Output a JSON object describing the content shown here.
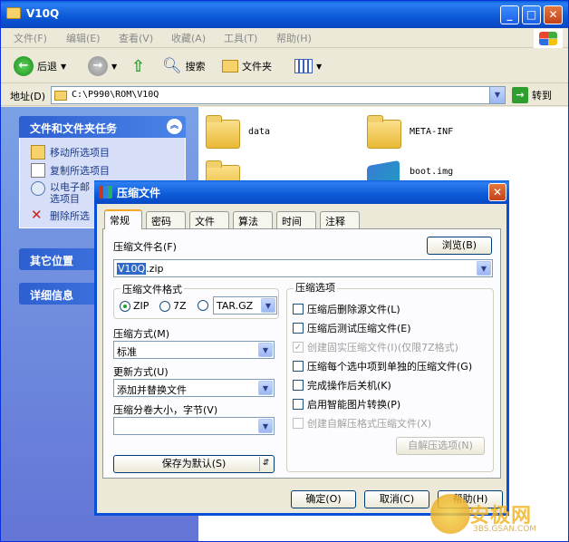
{
  "window": {
    "title": "V10Q"
  },
  "menu": [
    "文件(F)",
    "编辑(E)",
    "查看(V)",
    "收藏(A)",
    "工具(T)",
    "帮助(H)"
  ],
  "toolbar": {
    "back": "后退",
    "search": "搜索",
    "folders": "文件夹"
  },
  "address": {
    "label": "地址(D)",
    "path": "C:\\P990\\ROM\\V10Q",
    "go": "转到"
  },
  "left_panel": {
    "tasks_title": "文件和文件夹任务",
    "tasks": [
      "移动所选项目",
      "复制所选项目",
      "以电子邮件形式发送所选项目",
      "删除所选项目"
    ],
    "task_email_line1": "以电子邮",
    "task_email_line2": "选项目",
    "task_delete_short": "删除所选",
    "other_places": "其它位置",
    "details": "详细信息"
  },
  "files": [
    {
      "name": "data"
    },
    {
      "name": "META-INF"
    },
    {
      "name": "boot.img"
    }
  ],
  "dialog": {
    "title": "压缩文件",
    "tabs": [
      "常规",
      "密码",
      "文件",
      "算法",
      "时间",
      "注释"
    ],
    "archive_name_label": "压缩文件名(F)",
    "browse": "浏览(B)",
    "archive_name_selected": "V10Q",
    "archive_name_ext": ".zip",
    "format_group": "压缩文件格式",
    "formats": [
      {
        "label": "ZIP",
        "selected": true
      },
      {
        "label": "7Z",
        "selected": false
      },
      {
        "label": "TAR.GZ",
        "selected": false
      }
    ],
    "method_label": "压缩方式(M)",
    "method_value": "标准",
    "update_label": "更新方式(U)",
    "update_value": "添加并替换文件",
    "split_label": "压缩分卷大小，字节(V)",
    "split_value": "",
    "save_default": "保存为默认(S)",
    "options_group": "压缩选项",
    "options": [
      {
        "label": "压缩后删除源文件(L)",
        "checked": false,
        "disabled": false
      },
      {
        "label": "压缩后测试压缩文件(E)",
        "checked": false,
        "disabled": false
      },
      {
        "label": "创建固实压缩文件(I)(仅限7Z格式)",
        "checked": true,
        "disabled": true
      },
      {
        "label": "压缩每个选中项到单独的压缩文件(G)",
        "checked": false,
        "disabled": false
      },
      {
        "label": "完成操作后关机(K)",
        "checked": false,
        "disabled": false
      },
      {
        "label": "启用智能图片转换(P)",
        "checked": false,
        "disabled": false
      },
      {
        "label": "创建自解压格式压缩文件(X)",
        "checked": false,
        "disabled": true
      }
    ],
    "sfx_options": "自解压选项(N)",
    "ok": "确定(O)",
    "cancel": "取消(C)",
    "help": "帮助(H)"
  },
  "watermark": {
    "text": "安极网",
    "sub": "3BS.GSAN.COM"
  }
}
